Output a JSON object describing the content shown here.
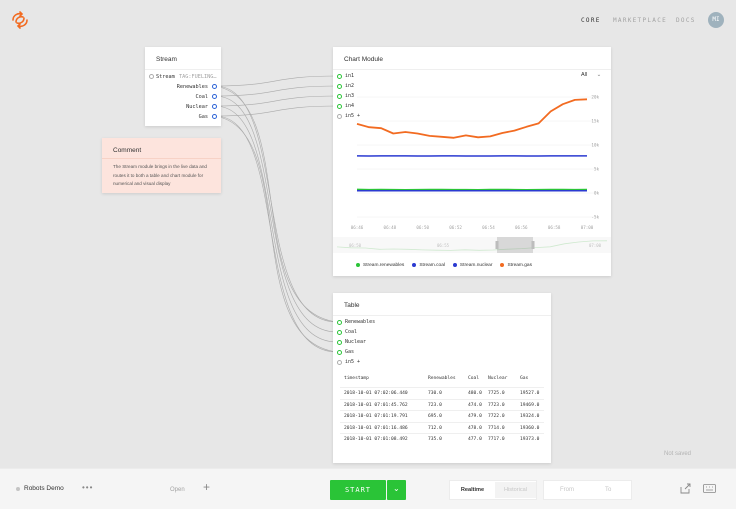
{
  "nav": {
    "core": "CORE",
    "marketplace": "MARKETPLACE",
    "docs": "DOCS",
    "avatar": "MI"
  },
  "stream": {
    "title": "Stream",
    "stream_label": "Stream",
    "stream_value": "TAG:FUELING…",
    "outputs": [
      "Renewables",
      "Coal",
      "Nuclear",
      "Gas"
    ]
  },
  "comment": {
    "title": "Comment",
    "text": "The Stream module brings in the live data and routes it to both a table and chart module for numerical and visual display"
  },
  "chart": {
    "title": "Chart Module",
    "inputs": [
      "in1",
      "in2",
      "in3",
      "in4",
      "in5 +"
    ],
    "range": "All",
    "chart_data": {
      "type": "line",
      "x": [
        "06:46",
        "06:48",
        "06:50",
        "06:52",
        "06:54",
        "06:56",
        "06:58",
        "07:00"
      ],
      "y_ticks": [
        "20k",
        "15k",
        "10k",
        "5k",
        "0k",
        "-5k"
      ],
      "ylim": [
        -5000,
        20000
      ],
      "series": [
        {
          "name": "Stream.renewables",
          "color": "#2ac437",
          "values": [
            750,
            700,
            730,
            710,
            690,
            700,
            720,
            730,
            710,
            700,
            690,
            720,
            730,
            700,
            680,
            700,
            720,
            730,
            710,
            730
          ]
        },
        {
          "name": "Stream.coal",
          "color": "#2b3ad1",
          "values": [
            480,
            470,
            475,
            480,
            470,
            465,
            470,
            475,
            480,
            470,
            470,
            475,
            480,
            470,
            475,
            480,
            470,
            475,
            478,
            480
          ]
        },
        {
          "name": "Stream.nuclear",
          "color": "#2b3ad1",
          "values": [
            7720,
            7718,
            7722,
            7725,
            7720,
            7715,
            7718,
            7720,
            7722,
            7718,
            7714,
            7716,
            7720,
            7722,
            7718,
            7716,
            7720,
            7722,
            7723,
            7725
          ]
        },
        {
          "name": "Stream.gas",
          "color": "#f26b21",
          "values": [
            14400,
            13700,
            13500,
            12400,
            12700,
            12400,
            11900,
            11700,
            11500,
            12000,
            11600,
            11800,
            12500,
            13000,
            13800,
            14500,
            17000,
            18500,
            19400,
            19527
          ]
        }
      ]
    },
    "legend": [
      "Stream.renewables",
      "Stream.coal",
      "Stream.nuclear",
      "Stream.gas"
    ],
    "nav_labels": [
      "06:50",
      "06:55",
      "07:00"
    ]
  },
  "table": {
    "title": "Table",
    "inputs": [
      "Renewables",
      "Coal",
      "Nuclear",
      "Gas",
      "in5 +"
    ],
    "columns": [
      "timestamp",
      "Renewables",
      "Coal",
      "Nuclear",
      "Gas"
    ],
    "rows": [
      [
        "2018-10-01 07:02:06.440",
        "730.0",
        "480.0",
        "7725.0",
        "19527.0"
      ],
      [
        "2018-10-01 07:01:45.762",
        "723.0",
        "474.0",
        "7723.0",
        "19469.0"
      ],
      [
        "2018-10-01 07:01:19.791",
        "695.0",
        "479.0",
        "7722.0",
        "19324.0"
      ],
      [
        "2018-10-01 07:01:16.486",
        "712.0",
        "478.0",
        "7714.0",
        "19360.0"
      ],
      [
        "2018-10-01 07:01:08.492",
        "735.0",
        "477.0",
        "7717.0",
        "19373.0"
      ]
    ]
  },
  "status": {
    "not_saved": "Not saved"
  },
  "bottom": {
    "canvas_name": "Robots Demo",
    "open": "Open",
    "start": "START",
    "realtime": "Realtime",
    "historical": "Historical",
    "from": "From",
    "to": "To"
  },
  "colors": {
    "accent": "#2ac437",
    "gas": "#f26b21",
    "coal": "#2b3ad1",
    "renewables": "#2ac437"
  }
}
